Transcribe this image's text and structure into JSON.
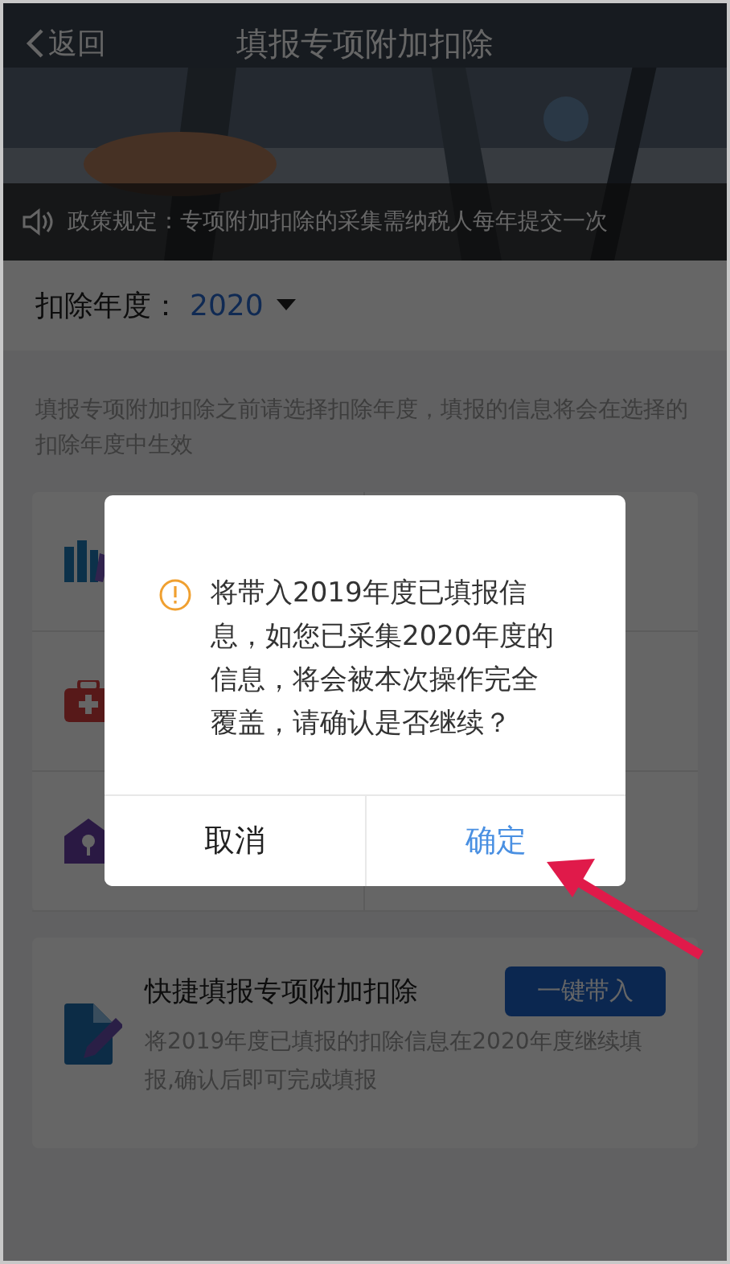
{
  "nav": {
    "back": "返回",
    "title": "填报专项附加扣除"
  },
  "notice": "政策规定：专项附加扣除的采集需纳税人每年提交一次",
  "year": {
    "label": "扣除年度：",
    "value": "2020"
  },
  "hint": "填报专项附加扣除之前请选择扣除年度，填报的信息将会在选择的扣除年度中生效",
  "categories": [
    {
      "kind": "books"
    },
    {
      "kind": "medical"
    },
    {
      "kind": "house"
    }
  ],
  "quick": {
    "title": "快捷填报专项附加扣除",
    "button": "一键带入",
    "description": "将2019年度已填报的扣除信息在2020年度继续填报,确认后即可完成填报"
  },
  "dialog": {
    "message": "将带入2019年度已填报信息，如您已采集2020年度的信息，将会被本次操作完全覆盖，请确认是否继续？",
    "buttons": [
      {
        "label": "取消",
        "primary": false
      },
      {
        "label": "确定",
        "primary": true
      }
    ]
  }
}
